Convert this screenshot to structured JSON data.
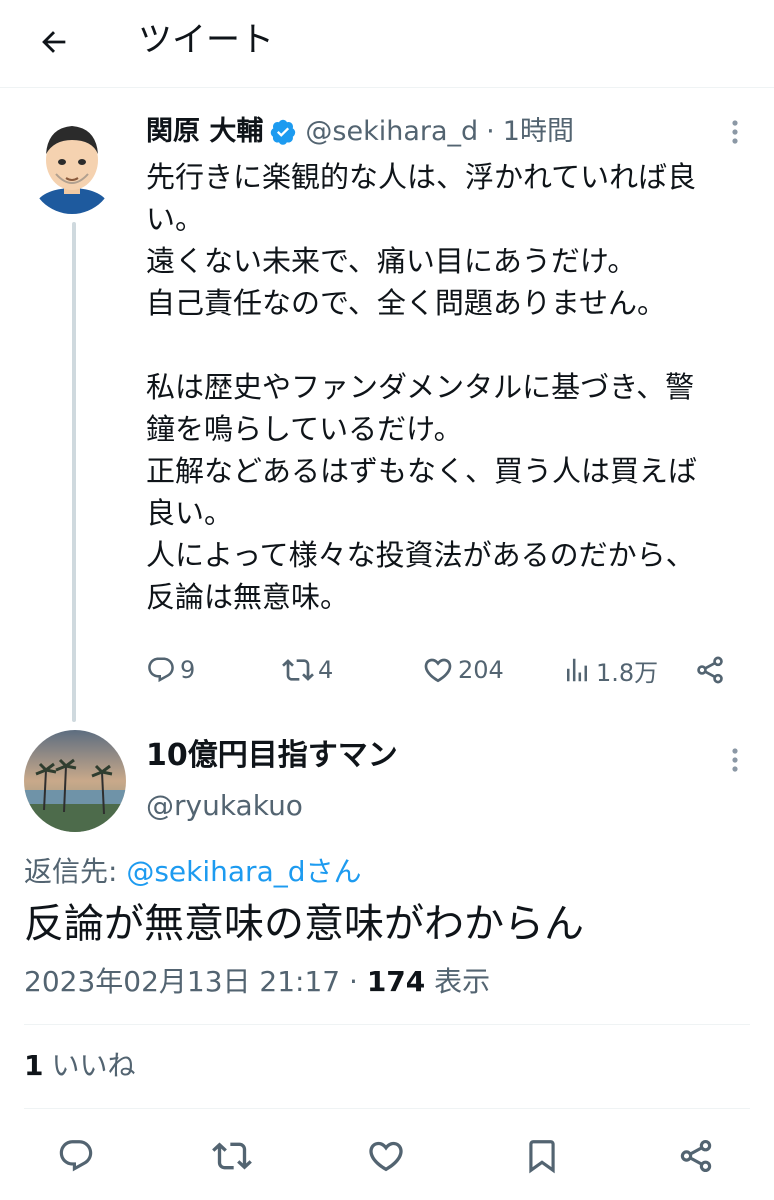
{
  "header": {
    "title": "ツイート",
    "back_icon": "back-arrow-icon"
  },
  "tweet": {
    "display_name": "関原 大輔",
    "handle": "@sekihara_d",
    "separator": "·",
    "time": "1時間",
    "verified_color": "#1d9bf0",
    "body_lines": [
      "先行きに楽観的な人は、浮かれていれば良",
      "い。",
      "遠くない未来で、痛い目にあうだけ。",
      "自己責任なので、全く問題ありません。",
      "",
      "私は歴史やファンダメンタルに基づき、警",
      "鐘を鳴らしているだけ。",
      "正解などあるはずもなく、買う人は買えば",
      "良い。",
      "人によって様々な投資法があるのだから、",
      "反論は無意味。"
    ],
    "stats": {
      "replies": "9",
      "retweets": "4",
      "likes": "204",
      "views": "1.8万"
    }
  },
  "reply": {
    "display_name": "10億円目指すマン",
    "handle": "@ryukakuo",
    "replying_to_prefix": "返信先: ",
    "replying_to_mention": "@sekihara_dさん",
    "text": "反論が無意味の意味がわからん",
    "date": "2023年02月13日 21:17",
    "separator": " · ",
    "views_count": "174",
    "views_label": " 表示",
    "likes_count": "1",
    "likes_label": "いいね"
  },
  "colors": {
    "accent": "#1d9bf0",
    "secondary_text": "#536471",
    "primary_text": "#0f1419",
    "thread_line": "#cfd9de"
  }
}
